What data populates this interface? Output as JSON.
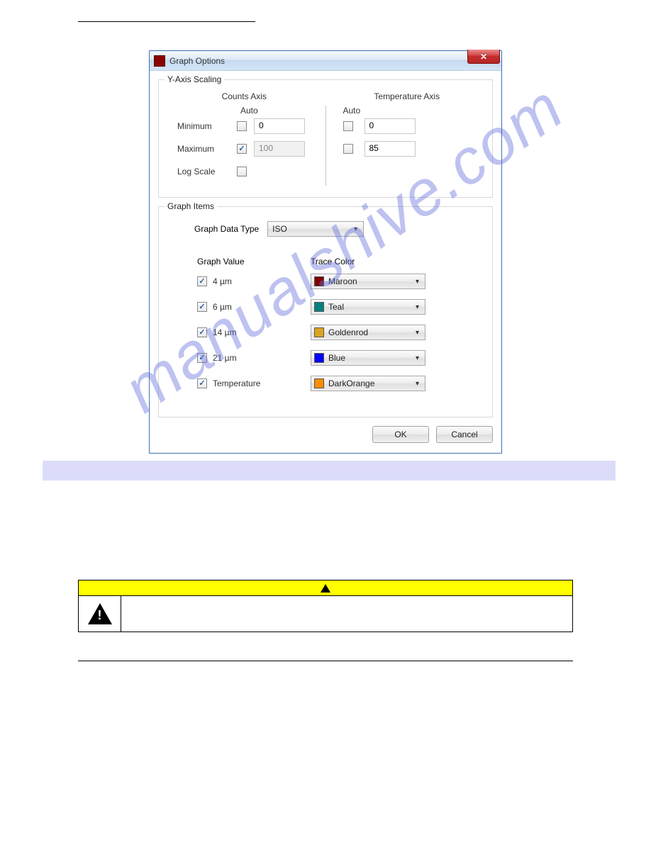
{
  "watermark": "manualshive.com",
  "dialog": {
    "title": "Graph Options",
    "close_icon": "x-icon",
    "groups": {
      "y_axis": {
        "legend": "Y-Axis Scaling",
        "counts": {
          "header": "Counts Axis",
          "auto_label": "Auto",
          "min_label": "Minimum",
          "min_auto_checked": false,
          "min_value": "0",
          "max_label": "Maximum",
          "max_auto_checked": true,
          "max_value": "100",
          "log_label": "Log Scale",
          "log_checked": false
        },
        "temp": {
          "header": "Temperature Axis",
          "auto_label": "Auto",
          "min_auto_checked": false,
          "min_value": "0",
          "max_auto_checked": false,
          "max_value": "85"
        }
      },
      "graph_items": {
        "legend": "Graph Items",
        "data_type_label": "Graph Data Type",
        "data_type_value": "ISO",
        "gv_header": "Graph Value",
        "tc_header": "Trace Color",
        "rows": [
          {
            "label": "4 µm",
            "checked": true,
            "color_name": "Maroon",
            "color_hex": "#800000"
          },
          {
            "label": "6 µm",
            "checked": true,
            "color_name": "Teal",
            "color_hex": "#008080"
          },
          {
            "label": "14 µm",
            "checked": true,
            "color_name": "Goldenrod",
            "color_hex": "#daa520"
          },
          {
            "label": "21 µm",
            "checked": true,
            "color_name": "Blue",
            "color_hex": "#0000ff"
          },
          {
            "label": "Temperature",
            "checked": true,
            "color_name": "DarkOrange",
            "color_hex": "#ff8c00"
          }
        ]
      }
    },
    "buttons": {
      "ok": "OK",
      "cancel": "Cancel"
    }
  }
}
